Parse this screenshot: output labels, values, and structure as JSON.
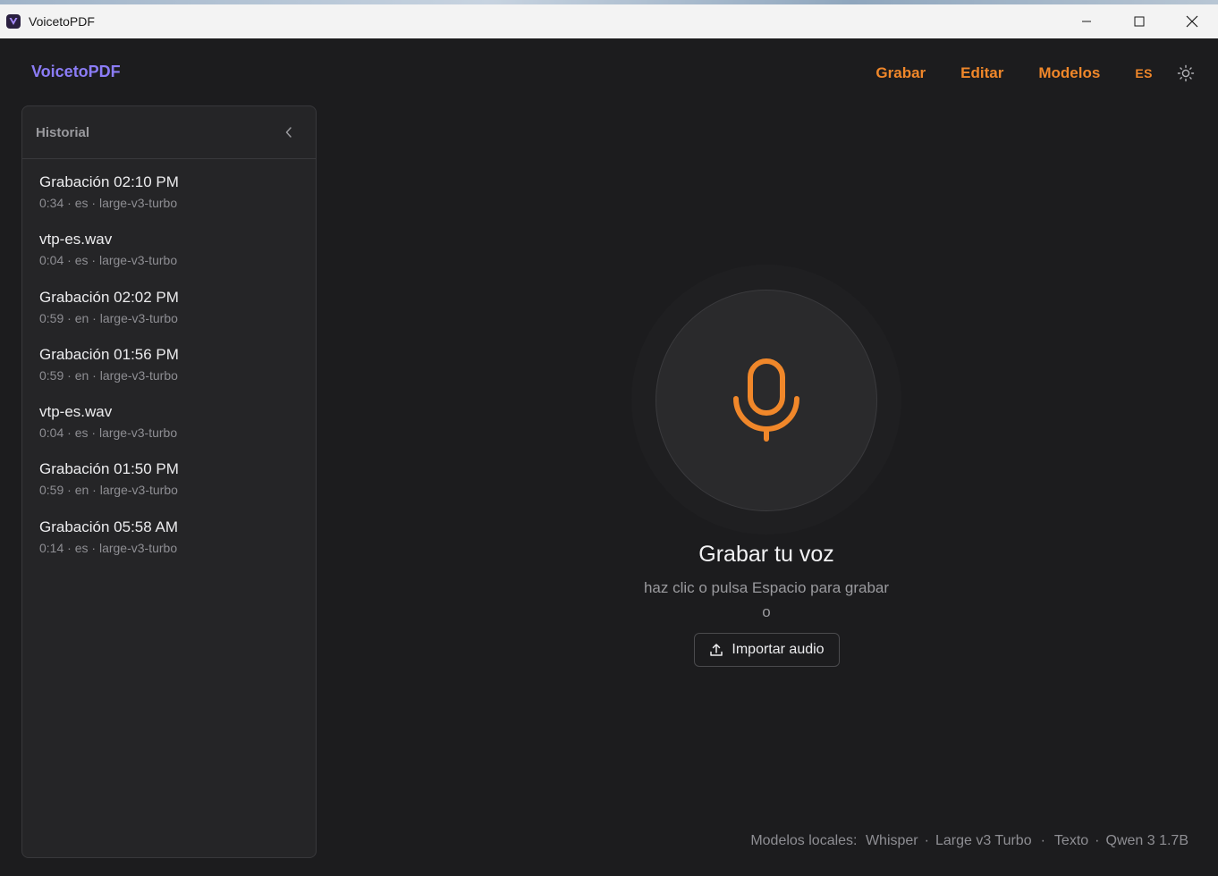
{
  "window": {
    "title": "VoicetoPDF"
  },
  "header": {
    "brand": "VoicetoPDF",
    "nav": [
      {
        "label": "Grabar"
      },
      {
        "label": "Editar"
      },
      {
        "label": "Modelos"
      }
    ],
    "language": "ES",
    "theme_icon": "sun-icon"
  },
  "sidebar": {
    "title": "Historial",
    "items": [
      {
        "title": "Grabación 02:10 PM",
        "duration": "0:34",
        "lang": "es",
        "model": "large-v3-turbo"
      },
      {
        "title": "vtp-es.wav",
        "duration": "0:04",
        "lang": "es",
        "model": "large-v3-turbo"
      },
      {
        "title": "Grabación 02:02 PM",
        "duration": "0:59",
        "lang": "en",
        "model": "large-v3-turbo"
      },
      {
        "title": "Grabación 01:56 PM",
        "duration": "0:59",
        "lang": "en",
        "model": "large-v3-turbo"
      },
      {
        "title": "vtp-es.wav",
        "duration": "0:04",
        "lang": "es",
        "model": "large-v3-turbo"
      },
      {
        "title": "Grabación 01:50 PM",
        "duration": "0:59",
        "lang": "en",
        "model": "large-v3-turbo"
      },
      {
        "title": "Grabación 05:58 AM",
        "duration": "0:14",
        "lang": "es",
        "model": "large-v3-turbo"
      }
    ]
  },
  "main": {
    "record_title": "Grabar tu voz",
    "record_hint": "haz clic o pulsa Espacio para grabar",
    "or_text": "o",
    "import_label": "Importar audio"
  },
  "footer": {
    "prefix": "Modelos locales:",
    "speech_engine": "Whisper",
    "speech_model": "Large v3 Turbo",
    "text_label": "Texto",
    "text_model": "Qwen 3 1.7B"
  },
  "colors": {
    "accent": "#f0872a",
    "brand": "#8b7cf6",
    "background": "#1c1c1e",
    "panel": "#252527"
  }
}
